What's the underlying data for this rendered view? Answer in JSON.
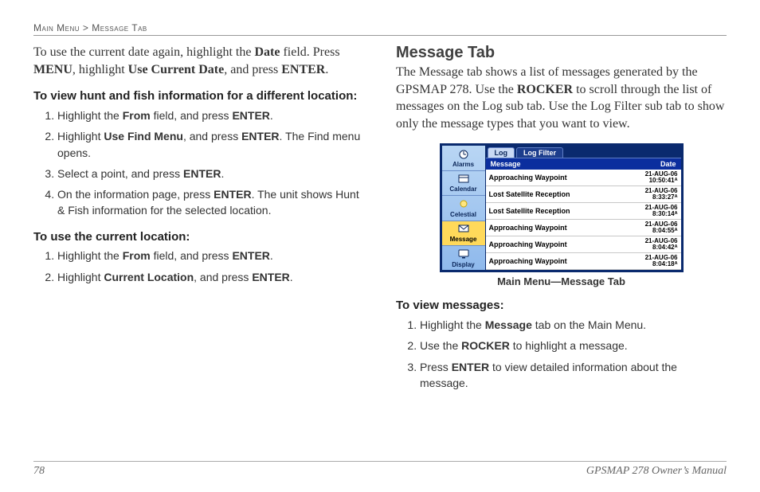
{
  "header": {
    "path": "Main Menu > Message Tab"
  },
  "left": {
    "intro_html": "To use the current date again, highlight the <b>Date</b> field. Press <b>MENU</b>, highlight <b>Use Current Date</b>, and press <b>ENTER</b>.",
    "section1": {
      "title": "To view hunt and fish information for a different location:",
      "items": [
        "Highlight the <b>From</b> field, and press <b>ENTER</b>.",
        "Highlight <b>Use Find Menu</b>, and press <b>ENTER</b>. The Find menu opens.",
        "Select a point, and press <b>ENTER</b>.",
        "On the information page, press <b>ENTER</b>. The unit shows Hunt & Fish information for the selected location."
      ]
    },
    "section2": {
      "title": "To use the current location:",
      "items": [
        "Highlight the <b>From</b> field, and press <b>ENTER</b>.",
        "Highlight <b>Current Location</b>, and press <b>ENTER</b>."
      ]
    }
  },
  "right": {
    "heading": "Message Tab",
    "para_html": "The Message tab shows a list of messages generated by the GPSMAP 278. Use the <b>ROCKER</b> to scroll through the list of messages on the Log sub tab. Use the Log Filter sub tab to show only the message types that you want to view.",
    "figure": {
      "sidebar": [
        {
          "label": "Alarms",
          "selected": false
        },
        {
          "label": "Calendar",
          "selected": false
        },
        {
          "label": "Celestial",
          "selected": false
        },
        {
          "label": "Message",
          "selected": true
        },
        {
          "label": "Display",
          "selected": false
        }
      ],
      "tabs": [
        {
          "label": "Log",
          "active": true
        },
        {
          "label": "Log Filter",
          "active": false
        }
      ],
      "columns": {
        "msg": "Message",
        "date": "Date"
      },
      "rows": [
        {
          "msg": "Approaching Waypoint",
          "d1": "21-AUG-06",
          "d2": "10:50:41ᴬ"
        },
        {
          "msg": "Lost Satellite Reception",
          "d1": "21-AUG-06",
          "d2": "8:33:27ᴬ"
        },
        {
          "msg": "Lost Satellite Reception",
          "d1": "21-AUG-06",
          "d2": "8:30:14ᴬ"
        },
        {
          "msg": "Approaching Waypoint",
          "d1": "21-AUG-06",
          "d2": "8:04:55ᴬ"
        },
        {
          "msg": "Approaching Waypoint",
          "d1": "21-AUG-06",
          "d2": "8:04:42ᴬ"
        },
        {
          "msg": "Approaching Waypoint",
          "d1": "21-AUG-06",
          "d2": "8:04:18ᴬ"
        }
      ],
      "caption": "Main Menu—Message Tab"
    },
    "section": {
      "title": "To view messages:",
      "items": [
        "Highlight the <b>Message</b> tab on the Main Menu.",
        "Use the <b>ROCKER</b> to highlight a message.",
        "Press <b>ENTER</b> to view detailed information about the message."
      ]
    }
  },
  "footer": {
    "page": "78",
    "doc": "GPSMAP 278 Owner’s Manual"
  }
}
